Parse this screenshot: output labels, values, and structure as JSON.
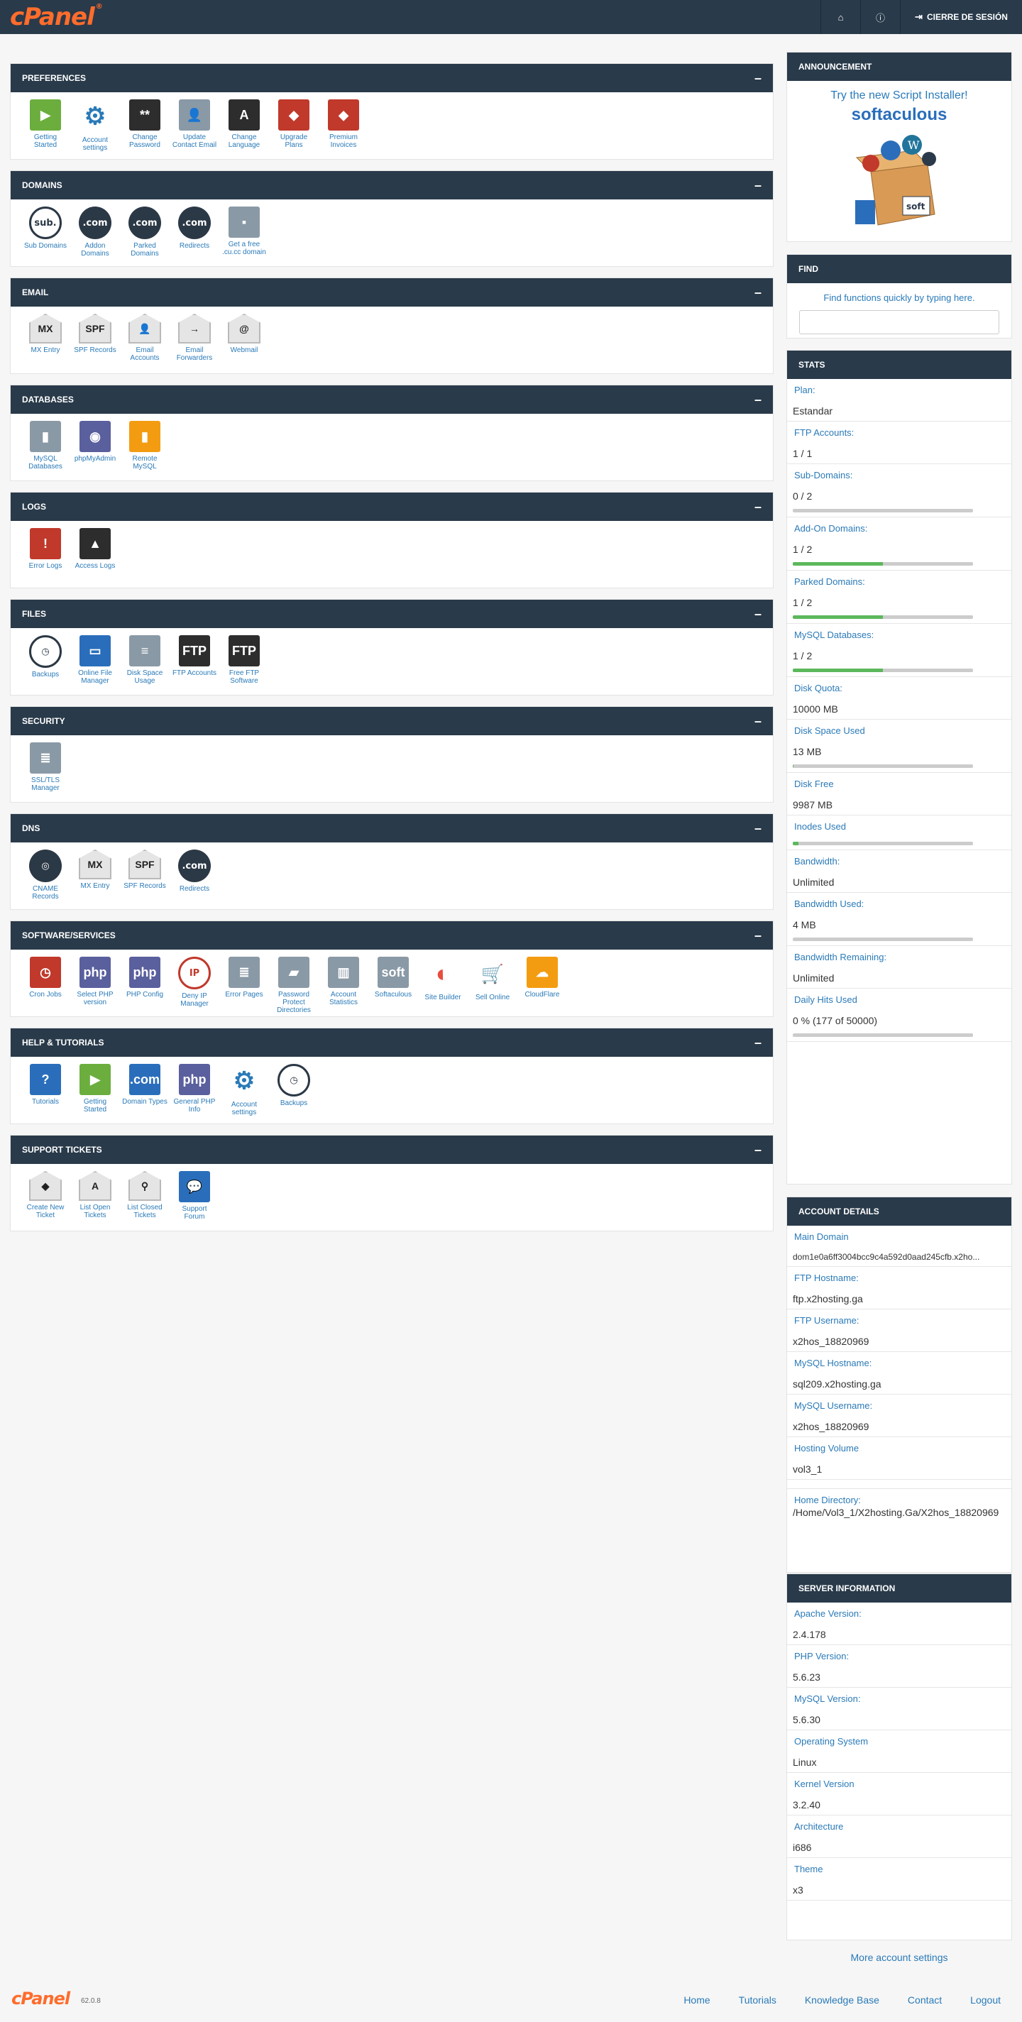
{
  "header": {
    "logo": "cPanel",
    "logo_tm": "®",
    "logout_label": "CIERRE DE SESIÓN"
  },
  "panels": [
    {
      "title": "PREFERENCES",
      "items": [
        {
          "icon": "getting-started-icon",
          "label": "Getting Started"
        },
        {
          "icon": "gear-icon",
          "label": "Account settings"
        },
        {
          "icon": "password-icon",
          "label": "Change Password"
        },
        {
          "icon": "contact-icon",
          "label": "Update Contact Email"
        },
        {
          "icon": "language-icon",
          "label": "Change Language"
        },
        {
          "icon": "upgrade-icon",
          "label": "Upgrade Plans"
        },
        {
          "icon": "invoice-icon",
          "label": "Premium Invoices"
        }
      ]
    },
    {
      "title": "DOMAINS",
      "items": [
        {
          "icon": "subdomain-icon",
          "label": "Sub Domains",
          "glyph": "sub."
        },
        {
          "icon": "addon-domain-icon",
          "label": "Addon Domains",
          "glyph": ".com"
        },
        {
          "icon": "parked-domain-icon",
          "label": "Parked Domains",
          "glyph": ".com"
        },
        {
          "icon": "redirect-icon",
          "label": "Redirects",
          "glyph": ".com"
        },
        {
          "icon": "free-domain-icon",
          "label": "Get a free .cu.cc domain"
        }
      ]
    },
    {
      "title": "EMAIL",
      "items": [
        {
          "icon": "mx-icon",
          "label": "MX Entry",
          "glyph": "MX"
        },
        {
          "icon": "spf-icon",
          "label": "SPF Records",
          "glyph": "SPF"
        },
        {
          "icon": "email-accounts-icon",
          "label": "Email Accounts",
          "glyph": "👤"
        },
        {
          "icon": "forwarder-icon",
          "label": "Email Forwarders",
          "glyph": "→"
        },
        {
          "icon": "webmail-icon",
          "label": "Webmail",
          "glyph": "@"
        }
      ]
    },
    {
      "title": "DATABASES",
      "items": [
        {
          "icon": "mysql-icon",
          "label": "MySQL Databases"
        },
        {
          "icon": "phpmyadmin-icon",
          "label": "phpMyAdmin"
        },
        {
          "icon": "remote-mysql-icon",
          "label": "Remote MySQL"
        }
      ]
    },
    {
      "title": "LOGS",
      "items": [
        {
          "icon": "error-log-icon",
          "label": "Error Logs",
          "glyph": "!"
        },
        {
          "icon": "access-log-icon",
          "label": "Access Logs",
          "glyph": "▲"
        }
      ]
    },
    {
      "title": "FILES",
      "items": [
        {
          "icon": "backup-icon",
          "label": "Backups"
        },
        {
          "icon": "file-manager-icon",
          "label": "Online File Manager"
        },
        {
          "icon": "disk-usage-icon",
          "label": "Disk Space Usage"
        },
        {
          "icon": "ftp-accounts-icon",
          "label": "FTP Accounts",
          "glyph": "FTP"
        },
        {
          "icon": "ftp-software-icon",
          "label": "Free FTP Software",
          "glyph": "FTP"
        }
      ]
    },
    {
      "title": "SECURITY",
      "items": [
        {
          "icon": "ssl-icon",
          "label": "SSL/TLS Manager"
        }
      ]
    },
    {
      "title": "DNS",
      "items": [
        {
          "icon": "cname-icon",
          "label": "CNAME Records"
        },
        {
          "icon": "mx-icon",
          "label": "MX Entry",
          "glyph": "MX"
        },
        {
          "icon": "spf-icon",
          "label": "SPF Records",
          "glyph": "SPF"
        },
        {
          "icon": "redirect-icon",
          "label": "Redirects",
          "glyph": ".com"
        }
      ]
    },
    {
      "title": "SOFTWARE/SERVICES",
      "items": [
        {
          "icon": "cron-icon",
          "label": "Cron Jobs"
        },
        {
          "icon": "php-icon",
          "label": "Select PHP version",
          "glyph": "php"
        },
        {
          "icon": "php-config-icon",
          "label": "PHP Config",
          "glyph": "php"
        },
        {
          "icon": "deny-ip-icon",
          "label": "Deny IP Manager",
          "glyph": "IP"
        },
        {
          "icon": "error-pages-icon",
          "label": "Error Pages"
        },
        {
          "icon": "folder-lock-icon",
          "label": "Password Protect Directories"
        },
        {
          "icon": "stats-icon",
          "label": "Account Statistics"
        },
        {
          "icon": "softaculous-icon",
          "label": "Softaculous",
          "glyph": "soft"
        },
        {
          "icon": "site-builder-icon",
          "label": "Site Builder"
        },
        {
          "icon": "cart-icon",
          "label": "Sell Online"
        },
        {
          "icon": "cloudflare-icon",
          "label": "CloudFlare"
        }
      ]
    },
    {
      "title": "HELP & TUTORIALS",
      "items": [
        {
          "icon": "question-icon",
          "label": "Tutorials",
          "glyph": "?"
        },
        {
          "icon": "getting-started-icon",
          "label": "Getting Started"
        },
        {
          "icon": "domain-types-icon",
          "label": "Domain Types",
          "glyph": ".com"
        },
        {
          "icon": "php-info-icon",
          "label": "General PHP Info",
          "glyph": "php"
        },
        {
          "icon": "gear-icon",
          "label": "Account settings"
        },
        {
          "icon": "backup-icon",
          "label": "Backups"
        }
      ]
    },
    {
      "title": "SUPPORT TICKETS",
      "items": [
        {
          "icon": "new-ticket-icon",
          "label": "Create New Ticket"
        },
        {
          "icon": "open-tickets-icon",
          "label": "List Open Tickets"
        },
        {
          "icon": "closed-tickets-icon",
          "label": "List Closed Tickets"
        },
        {
          "icon": "forum-icon",
          "label": "Support Forum"
        }
      ]
    }
  ],
  "announcement": {
    "title": "ANNOUNCEMENT",
    "text": "Try the new Script Installer!",
    "brand_soft": "soft",
    "brand_aculous": "aculous",
    "box_label": "soft"
  },
  "find": {
    "title": "FIND",
    "text": "Find functions quickly by typing here."
  },
  "stats": {
    "title": "STATS",
    "rows": [
      {
        "label": "Plan:",
        "value": "Estandar"
      },
      {
        "label": "FTP Accounts:",
        "value": "1 / 1"
      },
      {
        "label": "Sub-Domains:",
        "value": "0 / 2",
        "fill": 0
      },
      {
        "label": "Add-On Domains:",
        "value": "1 / 2",
        "fill": 0.5
      },
      {
        "label": "Parked Domains:",
        "value": "1 / 2",
        "fill": 0.5
      },
      {
        "label": "MySQL Databases:",
        "value": "1 / 2",
        "fill": 0.5
      },
      {
        "label": "Disk Quota:",
        "value": "10000 MB"
      },
      {
        "label": "Disk Space Used",
        "value": "13 MB",
        "fill": 0.001
      },
      {
        "label": "Disk Free",
        "value": "9987 MB"
      },
      {
        "label": "Inodes Used",
        "value": "",
        "fill": 0.03
      },
      {
        "label": "Bandwidth:",
        "value": "Unlimited"
      },
      {
        "label": "Bandwidth Used:",
        "value": "4 MB",
        "fill": 0
      },
      {
        "label": "Bandwidth Remaining:",
        "value": "Unlimited"
      },
      {
        "label": "Daily Hits Used",
        "value": "0 % (177 of 50000)",
        "fill": 0
      }
    ]
  },
  "account": {
    "title": "ACCOUNT DETAILS",
    "rows": [
      {
        "label": "Main Domain",
        "value": "dom1e0a6ff3004bcc9c4a592d0aad245cfb.x2ho..."
      },
      {
        "label": "FTP Hostname:",
        "value": "ftp.x2hosting.ga"
      },
      {
        "label": "FTP Username:",
        "value": "x2hos_18820969"
      },
      {
        "label": "MySQL Hostname:",
        "value": "sql209.x2hosting.ga"
      },
      {
        "label": "MySQL Username:",
        "value": "x2hos_18820969"
      },
      {
        "label": "Hosting Volume",
        "value": "vol3_1"
      }
    ],
    "home_label": "Home Directory:",
    "home_value": "/Home/Vol3_1/X2hosting.Ga/X2hos_18820969"
  },
  "server": {
    "title": "SERVER INFORMATION",
    "rows": [
      {
        "label": "Apache Version:",
        "value": "2.4.178"
      },
      {
        "label": "PHP Version:",
        "value": "5.6.23"
      },
      {
        "label": "MySQL Version:",
        "value": "5.6.30"
      },
      {
        "label": "Operating System",
        "value": "Linux"
      },
      {
        "label": "Kernel Version",
        "value": "3.2.40"
      },
      {
        "label": "Architecture",
        "value": "i686"
      },
      {
        "label": "Theme",
        "value": "x3"
      }
    ]
  },
  "more_settings": "More account settings",
  "footer": {
    "logo": "cPanel",
    "version": "62.0.8",
    "links": [
      "Home",
      "Tutorials",
      "Knowledge Base",
      "Contact",
      "Logout"
    ]
  },
  "colors": {
    "header_bg": "#293a4a",
    "brand": "#ff6c2c",
    "link": "#2a7ab8",
    "bar_fill": "#5cb85c"
  }
}
